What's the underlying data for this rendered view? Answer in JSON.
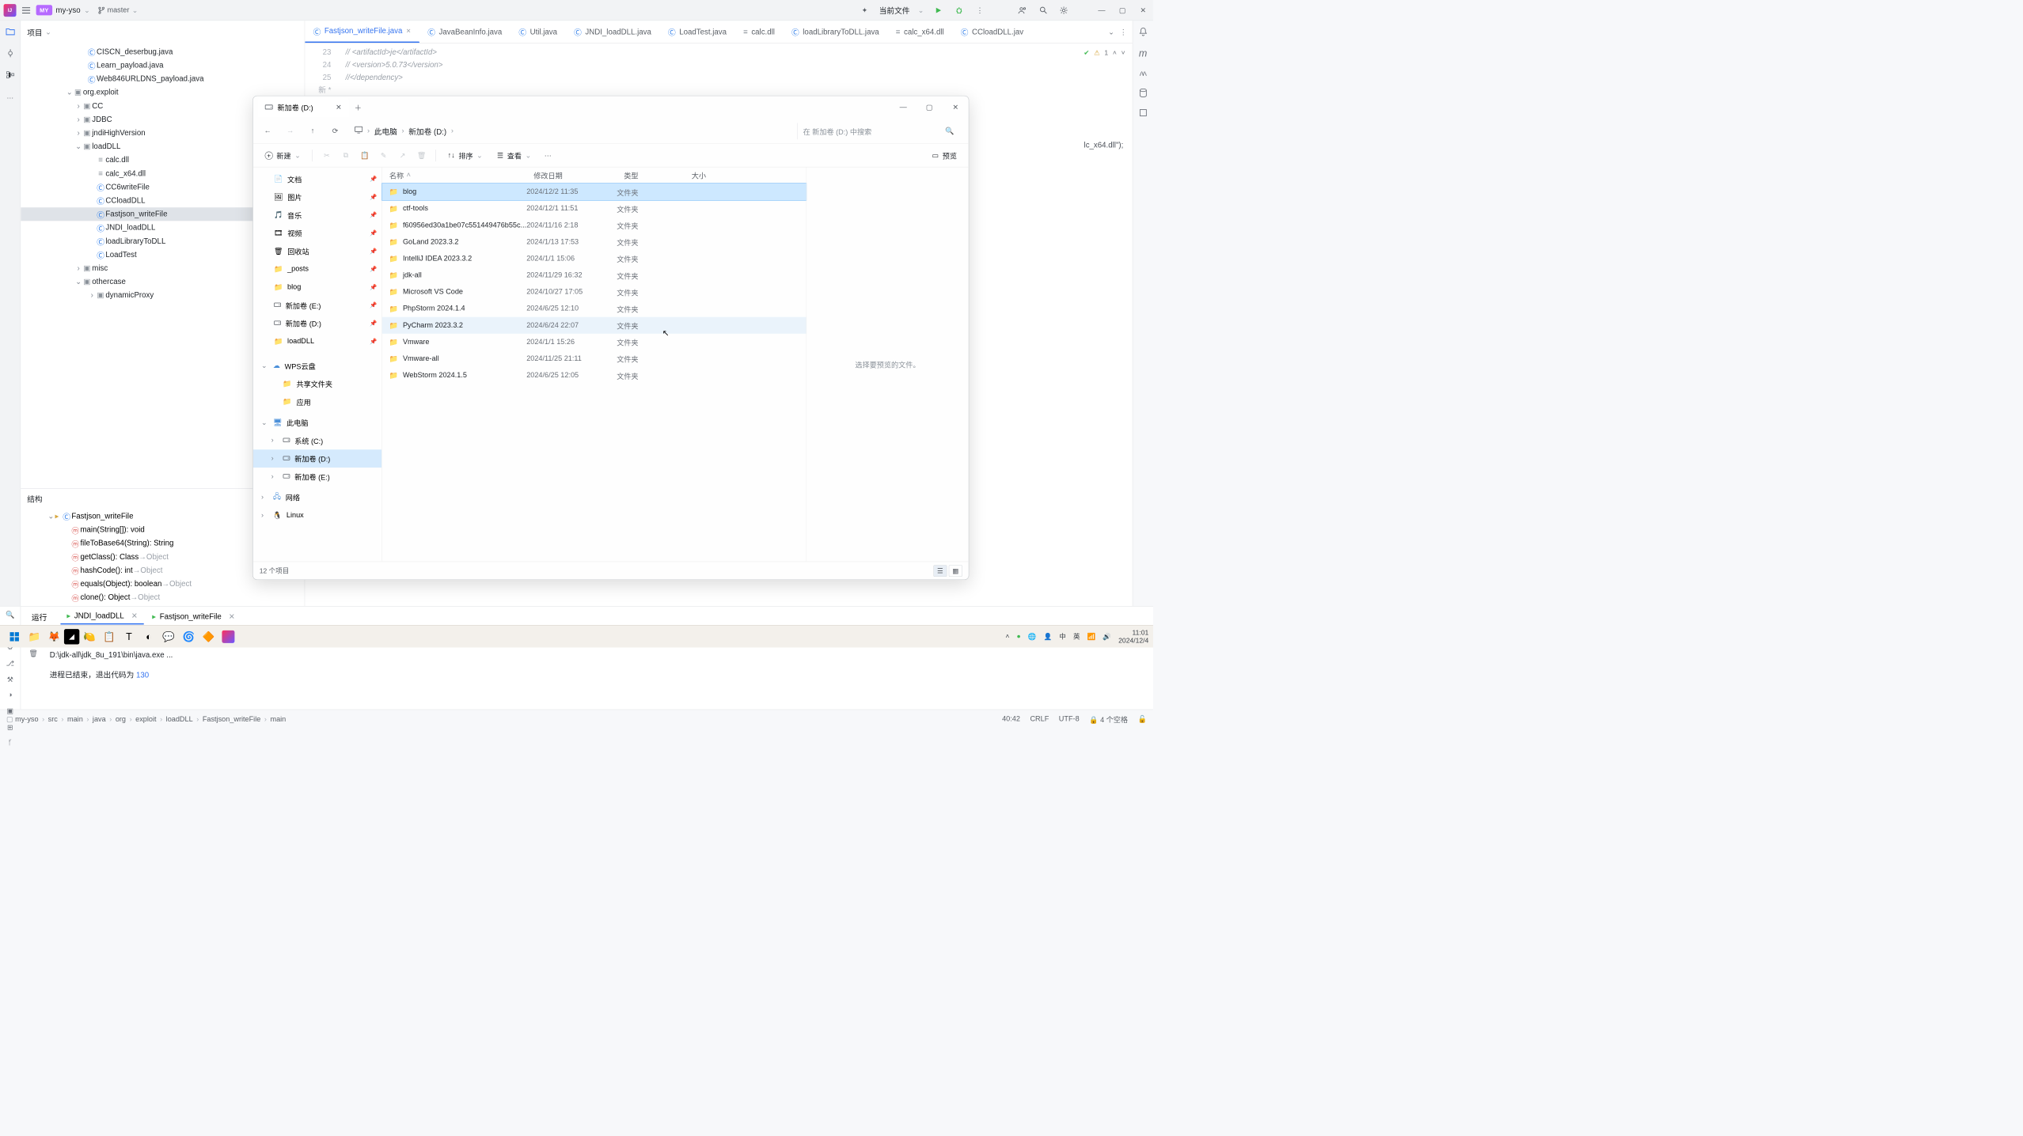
{
  "topbar": {
    "project_badge": "MY",
    "project_name": "my-yso",
    "branch": "master",
    "run_config": "当前文件"
  },
  "project_panel": {
    "title": "项目"
  },
  "project_tree": [
    {
      "indent": 130,
      "icon": "class",
      "label": "CISCN_deserbug.java"
    },
    {
      "indent": 130,
      "icon": "class",
      "label": "Learn_payload.java"
    },
    {
      "indent": 130,
      "icon": "class",
      "label": "Web846URLDNS_payload.java"
    },
    {
      "indent": 100,
      "icon": "pkg",
      "label": "org.exploit",
      "chev": "down"
    },
    {
      "indent": 120,
      "icon": "pkg",
      "label": "CC",
      "chev": "right"
    },
    {
      "indent": 120,
      "icon": "pkg",
      "label": "JDBC",
      "chev": "right"
    },
    {
      "indent": 120,
      "icon": "pkg",
      "label": "jndiHighVersion",
      "chev": "right"
    },
    {
      "indent": 120,
      "icon": "pkg",
      "label": "loadDLL",
      "chev": "down"
    },
    {
      "indent": 150,
      "icon": "file",
      "label": "calc.dll"
    },
    {
      "indent": 150,
      "icon": "file",
      "label": "calc_x64.dll"
    },
    {
      "indent": 150,
      "icon": "class",
      "label": "CC6writeFile"
    },
    {
      "indent": 150,
      "icon": "class",
      "label": "CCloadDLL"
    },
    {
      "indent": 150,
      "icon": "class",
      "label": "Fastjson_writeFile",
      "selected": true
    },
    {
      "indent": 150,
      "icon": "class",
      "label": "JNDI_loadDLL"
    },
    {
      "indent": 150,
      "icon": "class",
      "label": "loadLibraryToDLL"
    },
    {
      "indent": 150,
      "icon": "class",
      "label": "LoadTest"
    },
    {
      "indent": 120,
      "icon": "pkg",
      "label": "misc",
      "chev": "right"
    },
    {
      "indent": 120,
      "icon": "pkg",
      "label": "othercase",
      "chev": "down"
    },
    {
      "indent": 150,
      "icon": "pkg",
      "label": "dynamicProxy",
      "chev": "right"
    }
  ],
  "structure": {
    "title": "结构",
    "root": "Fastjson_writeFile",
    "items": [
      {
        "label": "main(String[]): void"
      },
      {
        "label": "fileToBase64(String): String"
      },
      {
        "label": "getClass(): Class<?> →Object",
        "ret": true
      },
      {
        "label": "hashCode(): int →Object",
        "ret": true
      },
      {
        "label": "equals(Object): boolean →Object",
        "ret": true
      },
      {
        "label": "clone(): Object →Object",
        "ret": true
      }
    ]
  },
  "editor": {
    "tabs": [
      {
        "label": "Fastjson_writeFile.java",
        "active": true,
        "icon": "class"
      },
      {
        "label": "JavaBeanInfo.java",
        "icon": "class"
      },
      {
        "label": "Util.java",
        "icon": "class"
      },
      {
        "label": "JNDI_loadDLL.java",
        "icon": "class"
      },
      {
        "label": "LoadTest.java",
        "icon": "class"
      },
      {
        "label": "calc.dll",
        "icon": "file"
      },
      {
        "label": "loadLibraryToDLL.java",
        "icon": "class"
      },
      {
        "label": "calc_x64.dll",
        "icon": "file"
      },
      {
        "label": "CCloadDLL.jav",
        "icon": "class"
      }
    ],
    "lines": [
      {
        "n": "23",
        "text": "//    <artifactId>je</artifactId>",
        "cls": "comment"
      },
      {
        "n": "24",
        "text": "//    <version>5.0.73</version>",
        "cls": "comment"
      },
      {
        "n": "25",
        "text": "//</dependency>",
        "cls": "comment"
      },
      {
        "n": "新 *",
        "text": "",
        "cls": "new-kw"
      }
    ],
    "snippet_right": "lc_x64.dll\");",
    "warning_count": "1"
  },
  "run": {
    "title": "运行",
    "tabs": [
      {
        "label": "JNDI_loadDLL",
        "active": true
      },
      {
        "label": "Fastjson_writeFile"
      }
    ],
    "output_line1": "D:\\jdk-all\\jdk_8u_191\\bin\\java.exe ...",
    "output_line2_prefix": "进程已结束，退出代码为 ",
    "output_line2_code": "130"
  },
  "breadcrumb": {
    "parts": [
      "my-yso",
      "src",
      "main",
      "java",
      "org",
      "exploit",
      "loadDLL",
      "Fastjson_writeFile",
      "main"
    ],
    "cursor": "40:42",
    "lineend": "CRLF",
    "encoding": "UTF-8",
    "indent": "4 个空格"
  },
  "explorer": {
    "tab_title": "新加卷 (D:)",
    "address": [
      "此电脑",
      "新加卷 (D:)"
    ],
    "search_placeholder": "在 新加卷 (D:) 中搜索",
    "new_btn": "新建",
    "sort_btn": "排序",
    "view_btn": "查看",
    "preview_btn": "预览",
    "headers": {
      "name": "名称",
      "date": "修改日期",
      "type": "类型",
      "size": "大小"
    },
    "preview_hint": "选择要预览的文件。",
    "status": "12 个项目",
    "nav_quick": [
      {
        "label": "文档",
        "icon": "doc",
        "pin": true
      },
      {
        "label": "图片",
        "icon": "pic",
        "pin": true
      },
      {
        "label": "音乐",
        "icon": "music",
        "pin": true
      },
      {
        "label": "视频",
        "icon": "video",
        "pin": true
      },
      {
        "label": "回收站",
        "icon": "trash",
        "pin": true
      },
      {
        "label": "_posts",
        "icon": "folder",
        "pin": true
      },
      {
        "label": "blog",
        "icon": "folder",
        "pin": true
      },
      {
        "label": "新加卷 (E:)",
        "icon": "drive",
        "pin": true
      },
      {
        "label": "新加卷 (D:)",
        "icon": "drive",
        "pin": true
      },
      {
        "label": "loadDLL",
        "icon": "folder",
        "pin": true
      }
    ],
    "nav_sections": [
      {
        "label": "WPS云盘",
        "icon": "cloud",
        "exp": "down",
        "children": [
          {
            "label": "共享文件夹",
            "icon": "folder"
          },
          {
            "label": "应用",
            "icon": "folder"
          }
        ]
      },
      {
        "label": "此电脑",
        "icon": "pc",
        "exp": "down",
        "children": [
          {
            "label": "系统 (C:)",
            "icon": "drive",
            "exp": "right"
          },
          {
            "label": "新加卷 (D:)",
            "icon": "drive",
            "exp": "right",
            "selected": true
          },
          {
            "label": "新加卷 (E:)",
            "icon": "drive",
            "exp": "right"
          }
        ]
      },
      {
        "label": "网络",
        "icon": "net",
        "exp": "right"
      },
      {
        "label": "Linux",
        "icon": "linux",
        "exp": "right"
      }
    ],
    "files": [
      {
        "name": "blog",
        "date": "2024/12/2 11:35",
        "type": "文件夹",
        "selected": true
      },
      {
        "name": "ctf-tools",
        "date": "2024/12/1 11:51",
        "type": "文件夹"
      },
      {
        "name": "f60956ed30a1be07c551449476b55c...",
        "date": "2024/11/16 2:18",
        "type": "文件夹"
      },
      {
        "name": "GoLand 2023.3.2",
        "date": "2024/1/13 17:53",
        "type": "文件夹"
      },
      {
        "name": "IntelliJ IDEA 2023.3.2",
        "date": "2024/1/1 15:06",
        "type": "文件夹"
      },
      {
        "name": "jdk-all",
        "date": "2024/11/29 16:32",
        "type": "文件夹"
      },
      {
        "name": "Microsoft VS Code",
        "date": "2024/10/27 17:05",
        "type": "文件夹"
      },
      {
        "name": "PhpStorm 2024.1.4",
        "date": "2024/6/25 12:10",
        "type": "文件夹"
      },
      {
        "name": "PyCharm 2023.3.2",
        "date": "2024/6/24 22:07",
        "type": "文件夹",
        "hover": true
      },
      {
        "name": "Vmware",
        "date": "2024/1/1 15:26",
        "type": "文件夹"
      },
      {
        "name": "Vmware-all",
        "date": "2024/11/25 21:11",
        "type": "文件夹"
      },
      {
        "name": "WebStorm 2024.1.5",
        "date": "2024/6/25 12:05",
        "type": "文件夹"
      }
    ]
  },
  "taskbar": {
    "time": "11:01",
    "date": "2024/12/4",
    "ime1": "中",
    "ime2": "英"
  }
}
